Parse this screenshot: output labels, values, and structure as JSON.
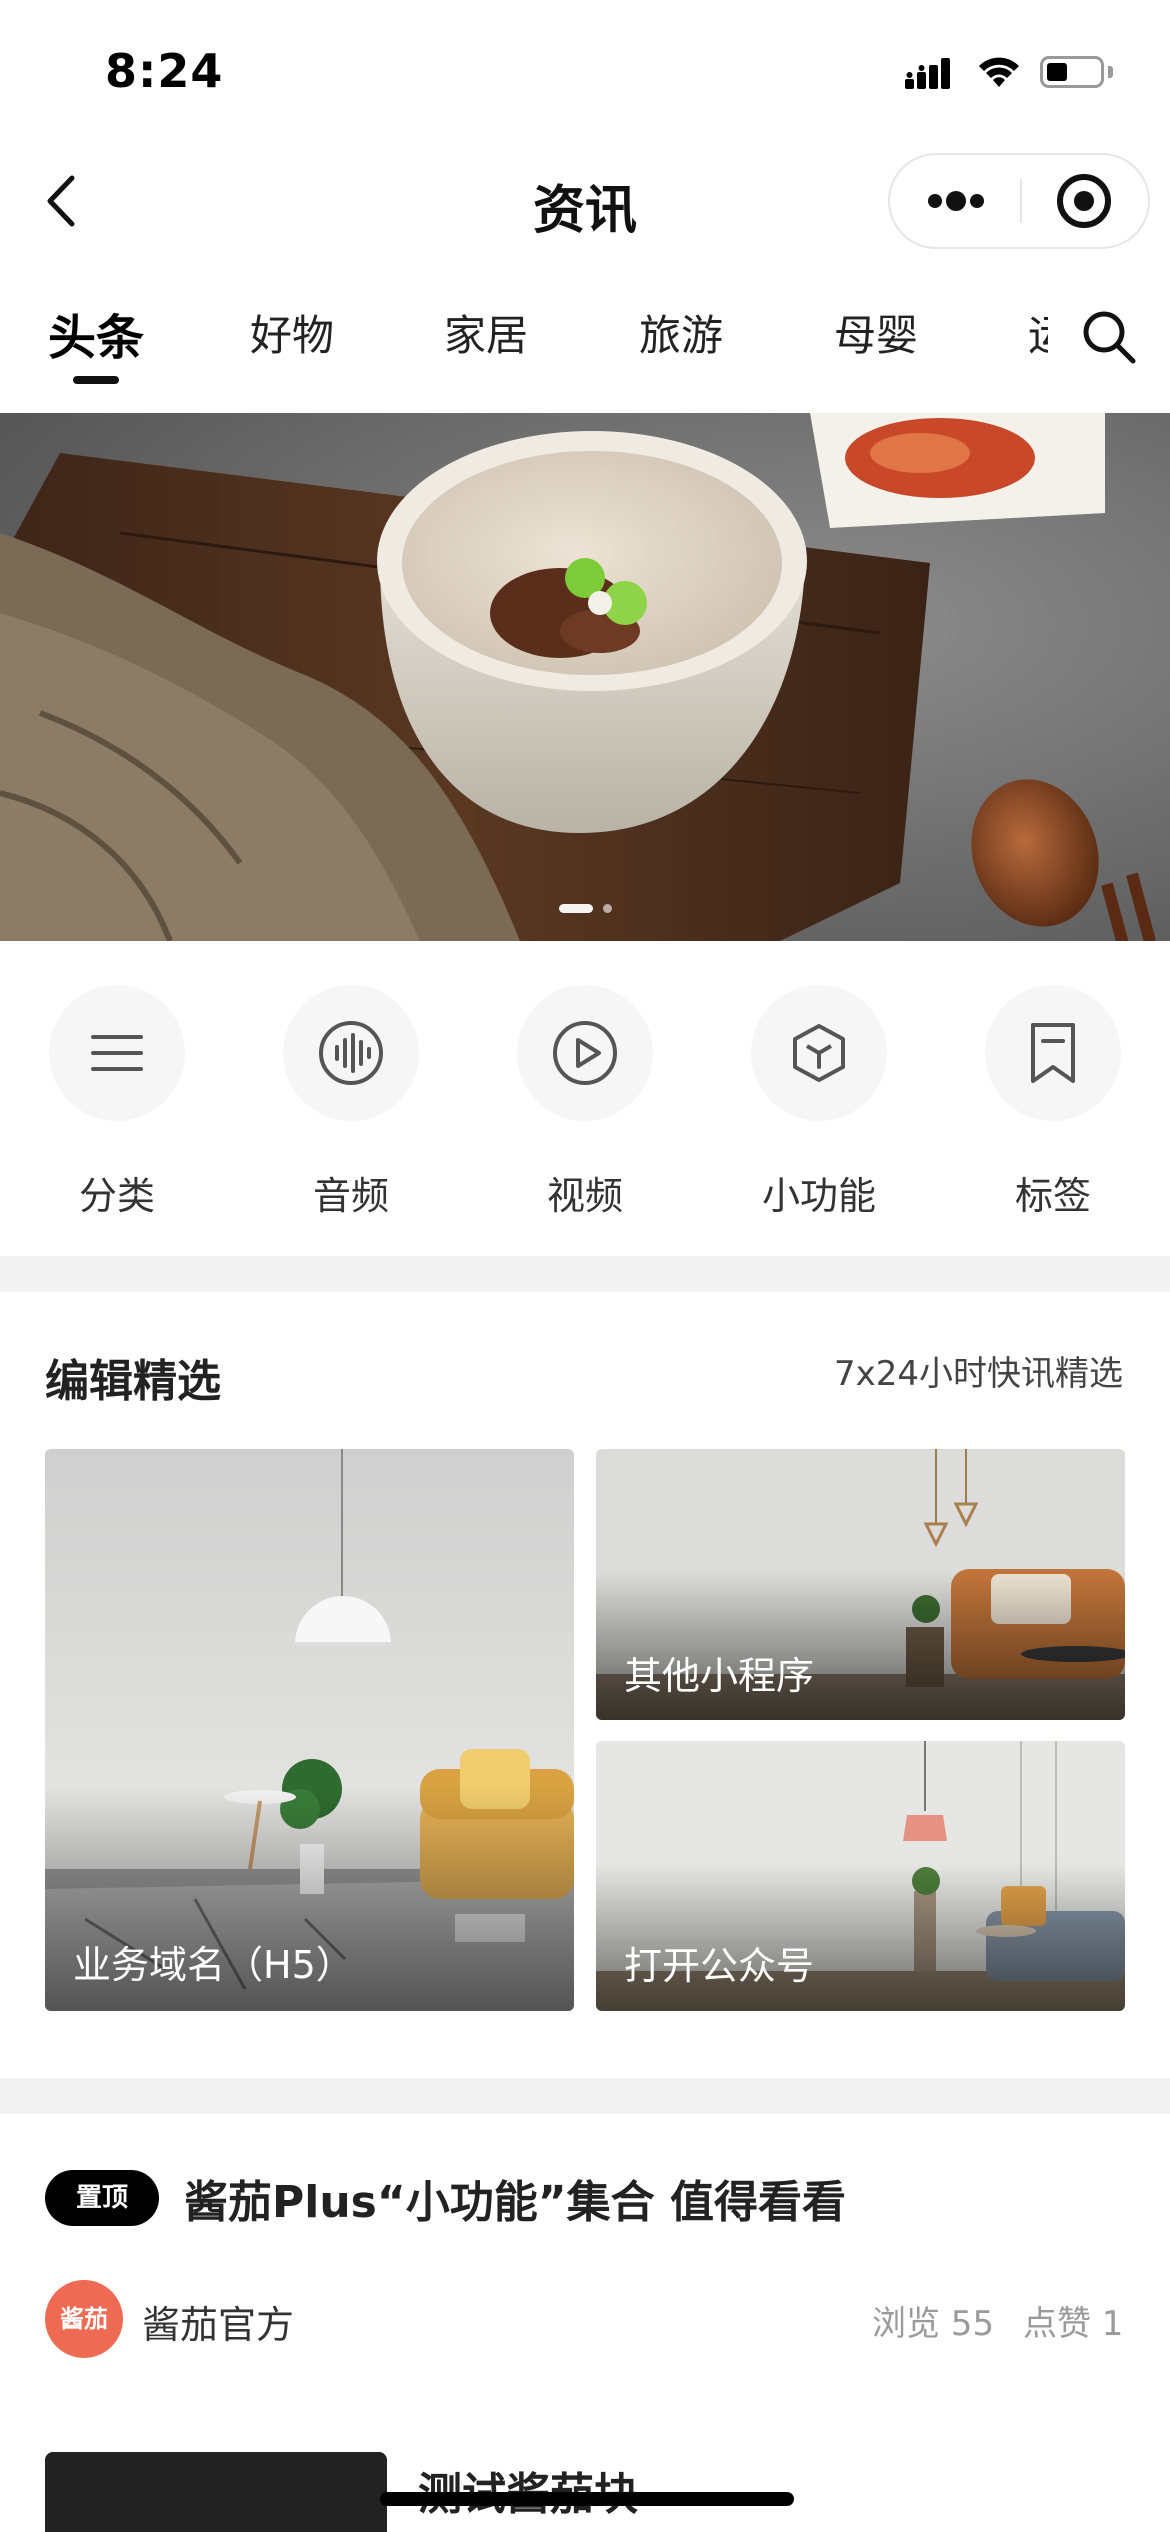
{
  "status_bar": {
    "time": "8:24"
  },
  "nav": {
    "title": "资讯"
  },
  "tabs": [
    {
      "label": "头条",
      "active": true
    },
    {
      "label": "好物",
      "active": false
    },
    {
      "label": "家居",
      "active": false
    },
    {
      "label": "旅游",
      "active": false
    },
    {
      "label": "母婴",
      "active": false
    },
    {
      "label": "运",
      "active": false
    }
  ],
  "banner": {
    "slides": 2,
    "current": 1
  },
  "quick_links": [
    {
      "label": "分类",
      "icon": "menu-icon"
    },
    {
      "label": "音频",
      "icon": "audio-wave-icon"
    },
    {
      "label": "视频",
      "icon": "play-icon"
    },
    {
      "label": "小功能",
      "icon": "cube-icon"
    },
    {
      "label": "标签",
      "icon": "bookmark-icon"
    }
  ],
  "editor_picks": {
    "title": "编辑精选",
    "subtitle": "7x24小时快讯精选",
    "cards": [
      {
        "label": "业务域名（H5）"
      },
      {
        "label": "其他小程序"
      },
      {
        "label": "打开公众号"
      }
    ]
  },
  "article": {
    "badge": "置顶",
    "title": "酱茄Plus“小功能”集合 值得看看",
    "author_avatar_text": "酱茄",
    "author": "酱茄官方",
    "views": "浏览 55",
    "likes": "点赞 1"
  },
  "next_article": {
    "title": "测试酱茄块"
  },
  "colors": {
    "accent": "#111111",
    "avatar": "#ee6a52",
    "muted": "#9a9a9a",
    "section_gap": "#f3f3f3"
  }
}
